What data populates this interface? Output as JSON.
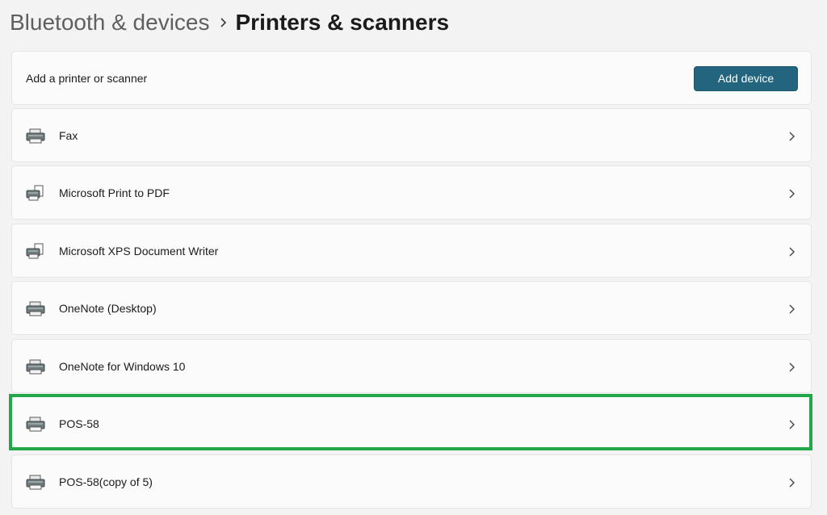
{
  "breadcrumb": {
    "parent": "Bluetooth & devices",
    "current": "Printers & scanners"
  },
  "add_section": {
    "label": "Add a printer or scanner",
    "button_label": "Add device"
  },
  "devices": [
    {
      "name": "Fax",
      "icon": "printer-icon"
    },
    {
      "name": "Microsoft Print to PDF",
      "icon": "printer-document-icon"
    },
    {
      "name": "Microsoft XPS Document Writer",
      "icon": "printer-document-icon"
    },
    {
      "name": "OneNote (Desktop)",
      "icon": "printer-icon"
    },
    {
      "name": "OneNote for Windows 10",
      "icon": "printer-icon"
    },
    {
      "name": "POS-58",
      "icon": "printer-icon",
      "highlighted": true
    },
    {
      "name": "POS-58(copy of 5)",
      "icon": "printer-icon"
    }
  ],
  "colors": {
    "accent_button": "#23647e",
    "highlight_border": "#22a849",
    "background": "#f3f3f3",
    "card": "#fbfbfb"
  }
}
